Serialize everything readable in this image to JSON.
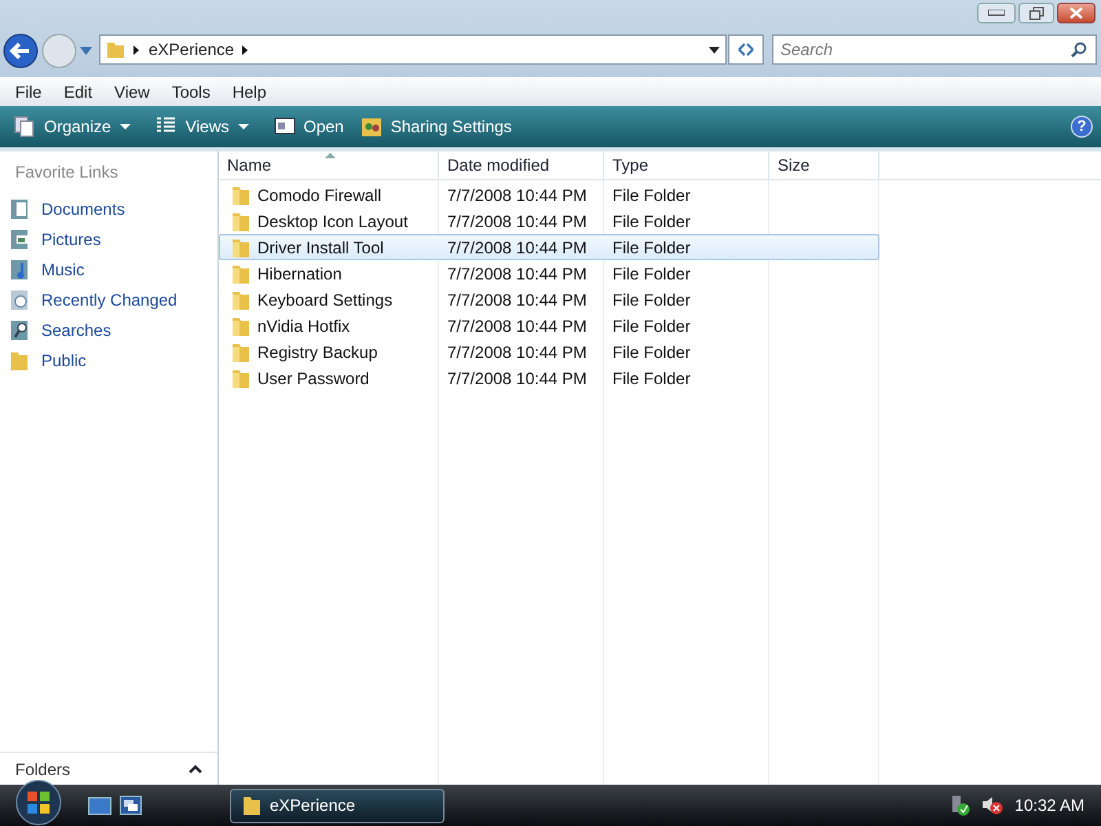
{
  "address_bar": {
    "crumbs": [
      "eXPerience"
    ]
  },
  "search": {
    "placeholder": "Search"
  },
  "help_button": "?",
  "menu": [
    "File",
    "Edit",
    "View",
    "Tools",
    "Help"
  ],
  "toolbar": [
    {
      "label": "Organize",
      "kind": "organize",
      "dropdown": true
    },
    {
      "label": "Views",
      "kind": "views",
      "dropdown": true
    },
    {
      "label": "Open",
      "kind": "open",
      "dropdown": false
    },
    {
      "label": "Sharing Settings",
      "kind": "sharing",
      "dropdown": false
    }
  ],
  "sidebar": {
    "title": "Favorite Links",
    "items": [
      {
        "label": "Documents",
        "kind": "documents"
      },
      {
        "label": "Pictures",
        "kind": "pictures"
      },
      {
        "label": "Music",
        "kind": "music"
      },
      {
        "label": "Recently Changed",
        "kind": "recent"
      },
      {
        "label": "Searches",
        "kind": "searches"
      },
      {
        "label": "Public",
        "kind": "folder"
      }
    ],
    "folders_label": "Folders"
  },
  "table": {
    "columns": [
      "Name",
      "Date modified",
      "Type",
      "Size"
    ],
    "rows": [
      {
        "name": "Comodo Firewall",
        "date": "7/7/2008 10:44 PM",
        "type": "File Folder",
        "selected": false
      },
      {
        "name": "Desktop Icon Layout",
        "date": "7/7/2008 10:44 PM",
        "type": "File Folder",
        "selected": false
      },
      {
        "name": "Driver Install Tool",
        "date": "7/7/2008 10:44 PM",
        "type": "File Folder",
        "selected": true
      },
      {
        "name": "Hibernation",
        "date": "7/7/2008 10:44 PM",
        "type": "File Folder",
        "selected": false
      },
      {
        "name": "Keyboard Settings",
        "date": "7/7/2008 10:44 PM",
        "type": "File Folder",
        "selected": false
      },
      {
        "name": "nVidia Hotfix",
        "date": "7/7/2008 10:44 PM",
        "type": "File Folder",
        "selected": false
      },
      {
        "name": "Registry Backup",
        "date": "7/7/2008 10:44 PM",
        "type": "File Folder",
        "selected": false
      },
      {
        "name": "User Password",
        "date": "7/7/2008 10:44 PM",
        "type": "File Folder",
        "selected": false
      }
    ]
  },
  "taskbar": {
    "window_button": "eXPerience",
    "clock": "10:32 AM"
  }
}
